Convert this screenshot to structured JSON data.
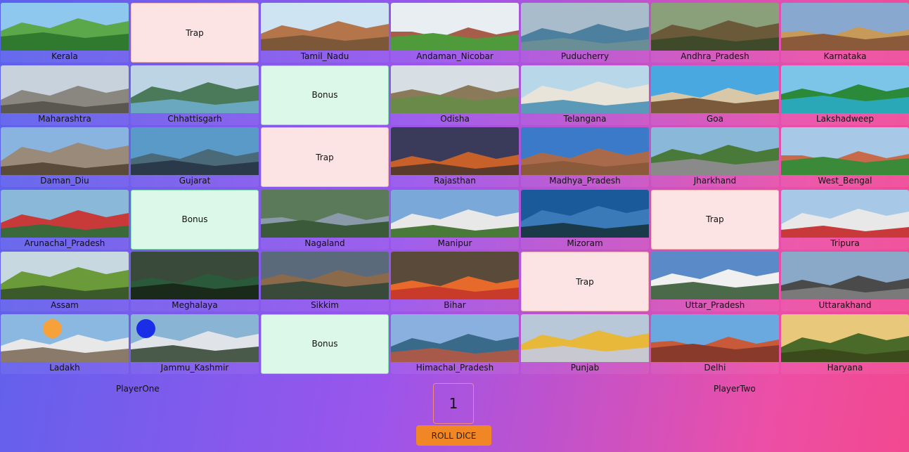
{
  "board": {
    "cells": [
      {
        "type": "state",
        "label": "Kerala",
        "colors": [
          "#8ec8ee",
          "#5aa84a",
          "#2f7a2f"
        ]
      },
      {
        "type": "trap",
        "label": "Trap"
      },
      {
        "type": "state",
        "label": "Tamil_Nadu",
        "colors": [
          "#cfe4f2",
          "#b5754a",
          "#7c5838"
        ]
      },
      {
        "type": "state",
        "label": "Andaman_Nicobar",
        "colors": [
          "#e8eef2",
          "#a85d4a",
          "#4f9a3a"
        ]
      },
      {
        "type": "state",
        "label": "Puducherry",
        "colors": [
          "#a8bccc",
          "#4d7f9e",
          "#6a8e96"
        ]
      },
      {
        "type": "state",
        "label": "Andhra_Pradesh",
        "colors": [
          "#8aa07a",
          "#6a5a3a",
          "#3f4a2a"
        ]
      },
      {
        "type": "state",
        "label": "Karnataka",
        "colors": [
          "#88a8d0",
          "#c79a5a",
          "#8a5a3a"
        ]
      },
      {
        "type": "state",
        "label": "Maharashtra",
        "colors": [
          "#c8d2dc",
          "#8a8680",
          "#5a5650"
        ]
      },
      {
        "type": "state",
        "label": "Chhattisgarh",
        "colors": [
          "#bcd4e4",
          "#4a7a5a",
          "#6aa8c0"
        ]
      },
      {
        "type": "bonus",
        "label": "Bonus"
      },
      {
        "type": "state",
        "label": "Odisha",
        "colors": [
          "#d8dfe4",
          "#8a7a5a",
          "#6a8a4a"
        ]
      },
      {
        "type": "state",
        "label": "Telangana",
        "colors": [
          "#b8d8ea",
          "#e8e4da",
          "#5a9ab8"
        ]
      },
      {
        "type": "state",
        "label": "Goa",
        "colors": [
          "#4aa8e0",
          "#d8c8a8",
          "#7a5a3a"
        ]
      },
      {
        "type": "state",
        "label": "Lakshadweep",
        "colors": [
          "#7cc4e8",
          "#2a8a3a",
          "#2aa8b8"
        ]
      },
      {
        "type": "state",
        "label": "Daman_Diu",
        "colors": [
          "#8ab4e0",
          "#9a8a7a",
          "#5a4a3a"
        ]
      },
      {
        "type": "state",
        "label": "Gujarat",
        "colors": [
          "#5a9ac8",
          "#4a6a7a",
          "#2a3a4a"
        ]
      },
      {
        "type": "trap",
        "label": "Trap"
      },
      {
        "type": "state",
        "label": "Rajasthan",
        "colors": [
          "#3a3a5a",
          "#c8602a",
          "#5a3a2a"
        ]
      },
      {
        "type": "state",
        "label": "Madhya_Pradesh",
        "colors": [
          "#3a7ac8",
          "#a86a4a",
          "#8a5a3a"
        ]
      },
      {
        "type": "state",
        "label": "Jharkhand",
        "colors": [
          "#8ab8d8",
          "#4a7a3a",
          "#8a8a8a"
        ]
      },
      {
        "type": "state",
        "label": "West_Bengal",
        "colors": [
          "#a8c8e8",
          "#c86a4a",
          "#3a8a3a"
        ]
      },
      {
        "type": "state",
        "label": "Arunachal_Pradesh",
        "colors": [
          "#8ab8d8",
          "#c83a3a",
          "#3a6a3a"
        ]
      },
      {
        "type": "bonus",
        "label": "Bonus"
      },
      {
        "type": "state",
        "label": "Nagaland",
        "colors": [
          "#5a7a5a",
          "#8a9aa8",
          "#3a5a3a"
        ]
      },
      {
        "type": "state",
        "label": "Manipur",
        "colors": [
          "#7aa8d8",
          "#e8e8e8",
          "#4a7a3a"
        ]
      },
      {
        "type": "state",
        "label": "Mizoram",
        "colors": [
          "#1a5a9a",
          "#3a7ab8",
          "#1a3a4a"
        ]
      },
      {
        "type": "trap",
        "label": "Trap"
      },
      {
        "type": "state",
        "label": "Tripura",
        "colors": [
          "#a8c8e8",
          "#e8e8e8",
          "#c83a3a"
        ]
      },
      {
        "type": "state",
        "label": "Assam",
        "colors": [
          "#c8d8e0",
          "#6a9a3a",
          "#3a5a2a"
        ]
      },
      {
        "type": "state",
        "label": "Meghalaya",
        "colors": [
          "#3a4a3a",
          "#2a5a3a",
          "#1a2a1a"
        ]
      },
      {
        "type": "state",
        "label": "Sikkim",
        "colors": [
          "#5a6a7a",
          "#8a6a4a",
          "#3a4a3a"
        ]
      },
      {
        "type": "state",
        "label": "Bihar",
        "colors": [
          "#5a4a3a",
          "#e86a2a",
          "#c83a2a"
        ]
      },
      {
        "type": "trap",
        "label": "Trap"
      },
      {
        "type": "state",
        "label": "Uttar_Pradesh",
        "colors": [
          "#5a8ac8",
          "#f0f0f0",
          "#4a6a4a"
        ]
      },
      {
        "type": "state",
        "label": "Uttarakhand",
        "colors": [
          "#8aa8c8",
          "#4a4a4a",
          "#7a7a7a"
        ]
      },
      {
        "type": "state",
        "label": "Ladakh",
        "colors": [
          "#8ab8e0",
          "#e8e8e8",
          "#8a7a6a"
        ]
      },
      {
        "type": "state",
        "label": "Jammu_Kashmir",
        "colors": [
          "#8ab4d4",
          "#e0e4e8",
          "#4a5a4a"
        ]
      },
      {
        "type": "bonus",
        "label": "Bonus"
      },
      {
        "type": "state",
        "label": "Himachal_Pradesh",
        "colors": [
          "#8ab0e0",
          "#3a6a8a",
          "#a85a4a"
        ]
      },
      {
        "type": "state",
        "label": "Punjab",
        "colors": [
          "#b8c8d8",
          "#e8b83a",
          "#c8c8d0"
        ]
      },
      {
        "type": "state",
        "label": "Delhi",
        "colors": [
          "#6aa8e0",
          "#c85a3a",
          "#8a3a2a"
        ]
      },
      {
        "type": "state",
        "label": "Haryana",
        "colors": [
          "#e8c87a",
          "#4a6a2a",
          "#3a4a1a"
        ]
      }
    ],
    "tokens": [
      {
        "player": "PlayerOne",
        "cell": "Ladakh",
        "color": "#f7a13a"
      },
      {
        "player": "PlayerTwo",
        "cell": "Jammu_Kashmir",
        "color": "#1a2ee8"
      }
    ]
  },
  "players": {
    "one": "PlayerOne",
    "two": "PlayerTwo"
  },
  "dice": {
    "value": "1",
    "roll_label": "ROLL DICE"
  }
}
